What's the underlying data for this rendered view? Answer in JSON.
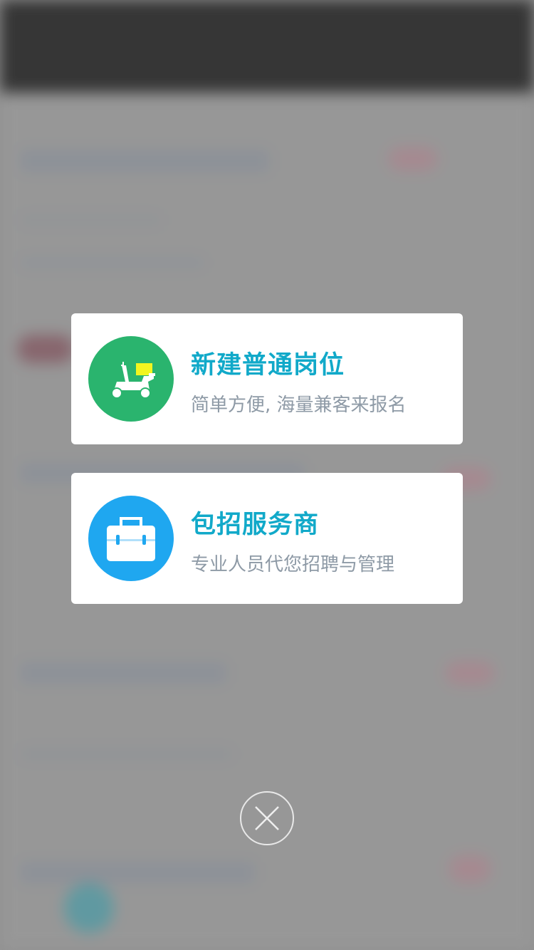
{
  "cards": [
    {
      "title": "新建普通岗位",
      "subtitle": "简单方便, 海量兼客来报名",
      "icon": "scooter-icon",
      "color": "#2ab46e"
    },
    {
      "title": "包招服务商",
      "subtitle": "专业人员代您招聘与管理",
      "icon": "briefcase-icon",
      "color": "#1fa7f0"
    }
  ],
  "close_icon": "close-icon",
  "accent_color": "#11a9c9"
}
